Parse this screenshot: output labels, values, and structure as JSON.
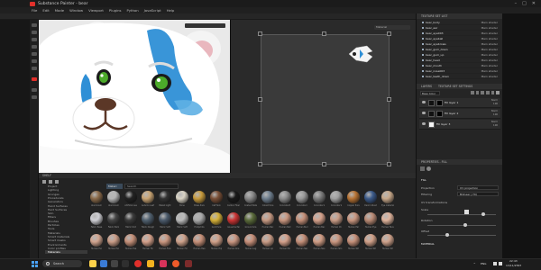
{
  "window": {
    "title": "Substance Painter - bear"
  },
  "menu": [
    "File",
    "Edit",
    "Mode",
    "Window",
    "Viewport",
    "Plugins",
    "Python",
    "JavaScript",
    "Help"
  ],
  "viewport2d": {
    "mode": "Material"
  },
  "texture_set_list": {
    "header": "TEXTURE SET LIST",
    "items": [
      {
        "name": "bear_body",
        "shader": "Main shader"
      },
      {
        "name": "bear_ear",
        "shader": "Main shader"
      },
      {
        "name": "bear_eye003",
        "shader": "Main shader"
      },
      {
        "name": "bear_eyeball",
        "shader": "Main shader"
      },
      {
        "name": "bear_eyebrows",
        "shader": "Main shader"
      },
      {
        "name": "bear_gum_down",
        "shader": "Main shader"
      },
      {
        "name": "bear_gum_up",
        "shader": "Main shader"
      },
      {
        "name": "bear_head",
        "shader": "Main shader"
      },
      {
        "name": "bear_mouth",
        "shader": "Main shader"
      },
      {
        "name": "bear_nose003",
        "shader": "Main shader"
      },
      {
        "name": "bear_teeth_down",
        "shader": "Main shader"
      }
    ]
  },
  "layers": {
    "header": "LAYERS",
    "tab2": "TEXTURE SET SETTINGS",
    "blend_select": "Base Color",
    "rows": [
      {
        "name": "Fill layer 1",
        "blend": "Norm",
        "opacity": "100"
      },
      {
        "name": "Fill layer 2",
        "blend": "Norm",
        "opacity": "100"
      },
      {
        "name": "Fill layer 3",
        "blend": "Norm",
        "opacity": "100"
      }
    ]
  },
  "properties": {
    "header": "PROPERTIES - FILL",
    "fill_label": "FILL",
    "projection_label": "Projection",
    "projection_value": "UV projection",
    "filtering_label": "Filtering",
    "filtering_value": "Bilinear | HQ",
    "uv_label": "UV transformations",
    "scale_label": "Scale",
    "rotation_label": "Rotation",
    "offset_label": "Offset",
    "material_label": "MATERIAL"
  },
  "shelf": {
    "header": "SHELF",
    "search_placeholder": "Search",
    "filter_chip": "Materi",
    "categories": [
      "Project",
      "Lighting",
      "Grunges",
      "Procedurals",
      "Generators",
      "Hand Surfaces",
      "Hard Surfaces",
      "Skin",
      "Filters",
      "Brushes",
      "Particles",
      "Tools",
      "Materials",
      "Smart materials",
      "Smart masks",
      "Environments",
      "Color profiles",
      "Materials"
    ],
    "selected_index": 17,
    "materials_row1": [
      "Aluminium",
      "Aluminium",
      "Artificial Lea",
      "Autumn Leaf",
      "Baked Light",
      "Bone",
      "Brass Pure",
      "Calf Skin",
      "Carbon Fiber",
      "Coated Meta",
      "Cobalt Pure",
      "Concrete B",
      "Concrete C",
      "Concrete S",
      "Concrete S",
      "Copper Pure",
      "Denim Rivet",
      "Eye material"
    ],
    "materials_row2": [
      "Fabric Base",
      "Fabric Bam",
      "Fabric Knit",
      "Fabric Rough",
      "Fabric Soft",
      "Fabric Soft",
      "Footprints",
      "Gold Pure",
      "Gouache Pai",
      "Ground Gra",
      "Human Bac",
      "Human Bell",
      "Human Bud",
      "Human Bac",
      "Human Ch",
      "Human Ear",
      "Human Eye",
      "Human Face"
    ],
    "materials_row3": [
      "Human Fac",
      "Human Fac",
      "Human Fee",
      "Human Fin",
      "Human Fore",
      "Human For",
      "Human Hea",
      "Human Hip",
      "Human Kne",
      "Human Leg",
      "Human Lip",
      "Human Mo",
      "Human Nec",
      "Human Nos",
      "Human Sho",
      "Human Wri",
      "Human Wri",
      "Human Wri"
    ]
  },
  "taskbar": {
    "search_placeholder": "Search",
    "lang": "ENG",
    "time": "22:43",
    "date": "13/11/2567"
  },
  "colors": {
    "accent_red": "#e2302b",
    "fur_blue": "#2e8fd6",
    "eye_green": "#4caa2a"
  }
}
